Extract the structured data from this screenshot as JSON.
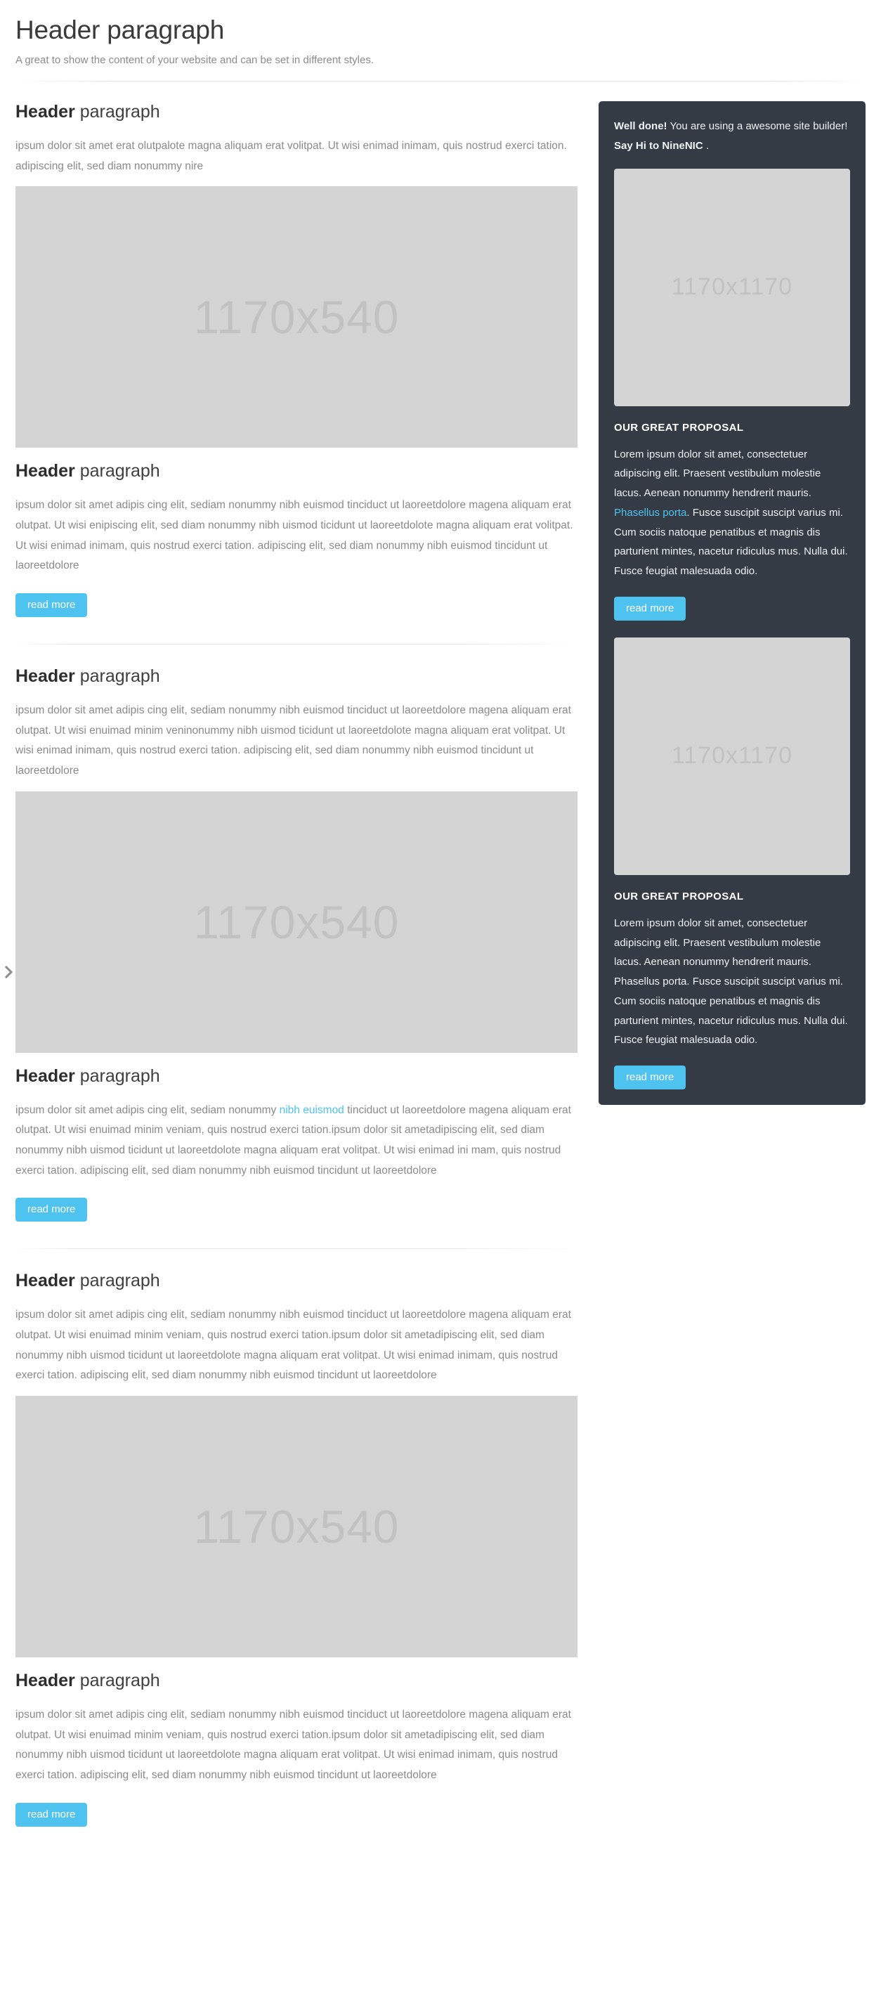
{
  "header": {
    "title": "Header paragraph",
    "subtitle": "A great to show the content of your website and can be set in different styles."
  },
  "icons": {
    "carousel_next": "chevron-right-icon"
  },
  "placeholders": {
    "main": "1170x540",
    "side": "1170x1170"
  },
  "buttons": {
    "read_more": "read more"
  },
  "main_blocks": [
    {
      "heading_bold": "Header",
      "heading_rest": " paragraph",
      "body": "ipsum dolor sit amet erat olutpalote magna aliquam erat volitpat. Ut wisi  enimad inimam, quis nostrud exerci tation. adipiscing elit, sed diam nonummy nire",
      "has_image": true,
      "has_button": false,
      "has_rule": false
    },
    {
      "heading_bold": "Header",
      "heading_rest": " paragraph",
      "body": "ipsum dolor sit amet adipis cing elit, sediam nonummy nibh euismod tinciduct ut laoreetdolore magena aliquam erat olutpat. Ut wisi enipiscing elit, sed diam nonummy nibh uismod ticidunt ut laoreetdolote magna aliquam erat volitpat. Ut wisi enimad inimam, quis nostrud exerci tation. adipiscing elit, sed diam nonummy nibh euismod tincidunt ut laoreetdolore",
      "has_image": false,
      "has_button": true,
      "has_rule": true
    },
    {
      "heading_bold": "Header",
      "heading_rest": " paragraph",
      "body": "ipsum dolor sit amet adipis cing elit, sediam nonummy nibh euismod tinciduct ut laoreetdolore magena aliquam erat olutpat. Ut wisi enuimad minim veninonummy nibh uismod ticidunt ut laoreetdolote magna aliquam erat volitpat. Ut wisi enimad inimam, quis nostrud exerci tation. adipiscing elit, sed diam nonummy nibh euismod tincidunt ut laoreetdolore",
      "has_image": true,
      "has_button": false,
      "has_rule": false
    },
    {
      "heading_bold": "Header",
      "heading_rest": " paragraph",
      "body_before_link": "ipsum dolor sit amet adipis cing elit, sediam nonummy ",
      "link_text": "nibh euismod",
      "body_after_link": " tinciduct ut laoreetdolore magena aliquam erat olutpat. Ut wisi enuimad minim veniam, quis nostrud exerci tation.ipsum dolor sit ametadipiscing elit, sed diam nonummy nibh uismod ticidunt ut laoreetdolote magna aliquam erat volitpat. Ut wisi enimad ini mam, quis nostrud exerci tation. adipiscing elit, sed diam nonummy nibh euismod tincidunt ut laoreetdolore",
      "has_image": false,
      "has_button": true,
      "has_rule": true
    },
    {
      "heading_bold": "Header",
      "heading_rest": " paragraph",
      "body": "ipsum dolor sit amet adipis cing elit, sediam nonummy nibh euismod tinciduct ut laoreetdolore magena aliquam erat olutpat. Ut wisi enuimad minim veniam, quis nostrud exerci tation.ipsum dolor sit ametadipiscing elit, sed diam nonummy nibh uismod ticidunt ut laoreetdolote magna aliquam erat volitpat. Ut wisi enimad inimam, quis nostrud exerci tation. adipiscing elit, sed diam nonummy nibh euismod tincidunt ut laoreetdolore",
      "has_image": true,
      "has_button": false,
      "has_rule": false
    },
    {
      "heading_bold": "Header",
      "heading_rest": " paragraph",
      "body": "ipsum dolor sit amet adipis cing elit, sediam nonummy nibh euismod tinciduct ut laoreetdolore magena aliquam erat olutpat. Ut wisi enuimad minim veniam, quis nostrud exerci tation.ipsum dolor sit ametadipiscing elit, sed diam nonummy nibh uismod ticidunt ut laoreetdolote magna aliquam erat volitpat. Ut wisi enimad inimam, quis nostrud exerci tation. adipiscing elit, sed diam nonummy nibh euismod tincidunt ut laoreetdolore",
      "has_image": false,
      "has_button": true,
      "has_rule": false
    }
  ],
  "sidebar": {
    "alert": {
      "strong_1": "Well done!",
      "text_1": " You are using a awesome site builder! ",
      "strong_2": "Say Hi to NineNIC",
      "text_2": " ."
    },
    "proposals": [
      {
        "title": "OUR GREAT PROPOSAL",
        "body_before_link": "Lorem ipsum dolor sit amet, consectetuer adipiscing elit. Praesent vestibulum molestie lacus. Aenean nonummy hendrerit mauris. ",
        "link_text": "Phasellus porta",
        "body_after_link": ". Fusce suscipit suscipt varius mi. Cum sociis natoque penatibus et magnis dis parturient mintes, nacetur ridiculus mus. Nulla dui. Fusce feugiat malesuada odio.",
        "button": "read more"
      },
      {
        "title": "OUR GREAT PROPOSAL",
        "body_before_link": "Lorem ipsum dolor sit amet, consectetuer adipiscing elit. Praesent vestibulum molestie lacus. Aenean nonummy hendrerit mauris. Phasellus porta. Fusce suscipit suscipt varius mi. Cum sociis natoque penatibus et magnis dis parturient mintes, nacetur ridiculus mus. Nulla dui. Fusce feugiat malesuada odio.",
        "link_text": "",
        "body_after_link": "",
        "button": "read more"
      }
    ]
  },
  "colors": {
    "accent": "#4ec3ef",
    "panel_bg": "#353b45",
    "placeholder_bg": "#d4d4d4",
    "placeholder_text": "#c2c2c2"
  }
}
